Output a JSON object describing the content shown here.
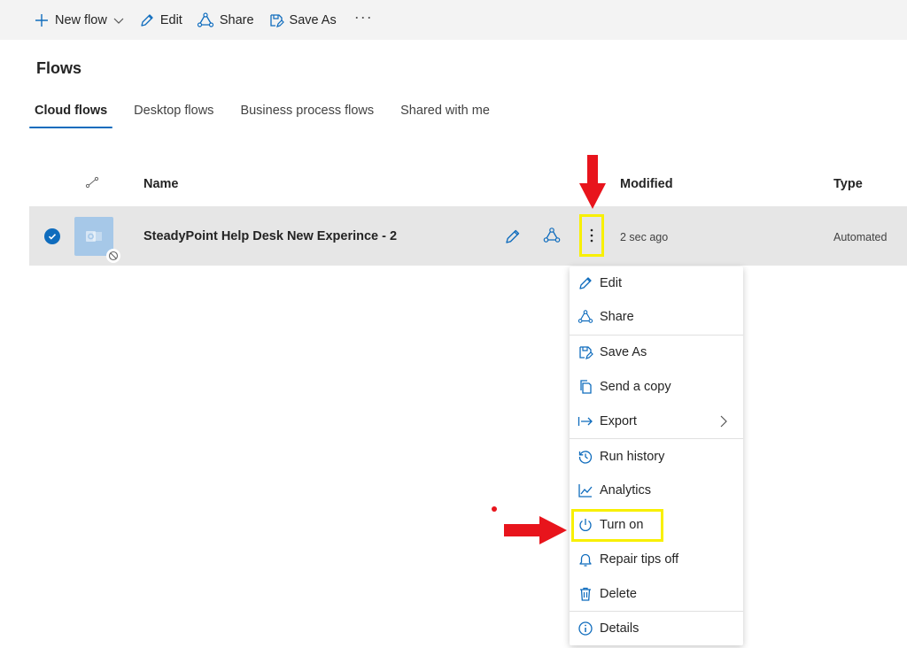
{
  "toolbar": {
    "new_flow": "New flow",
    "edit": "Edit",
    "share": "Share",
    "save_as": "Save As",
    "more": "···"
  },
  "page": {
    "title": "Flows"
  },
  "tabs": [
    {
      "label": "Cloud flows",
      "active": true
    },
    {
      "label": "Desktop flows",
      "active": false
    },
    {
      "label": "Business process flows",
      "active": false
    },
    {
      "label": "Shared with me",
      "active": false
    }
  ],
  "table": {
    "columns": {
      "name": "Name",
      "modified": "Modified",
      "type": "Type"
    },
    "rows": [
      {
        "name": "SteadyPoint Help Desk New Experince - 2",
        "modified": "2 sec ago",
        "type": "Automated",
        "selected": true
      }
    ]
  },
  "context_menu": {
    "items": [
      {
        "label": "Edit",
        "icon": "pencil-icon"
      },
      {
        "label": "Share",
        "icon": "share-icon"
      },
      {
        "label": "Save As",
        "icon": "save-as-icon"
      },
      {
        "label": "Send a copy",
        "icon": "copy-icon"
      },
      {
        "label": "Export",
        "icon": "export-icon",
        "has_submenu": true
      },
      {
        "label": "Run history",
        "icon": "history-icon"
      },
      {
        "label": "Analytics",
        "icon": "analytics-icon"
      },
      {
        "label": "Turn on",
        "icon": "power-icon",
        "highlighted": true
      },
      {
        "label": "Repair tips off",
        "icon": "bell-icon"
      },
      {
        "label": "Delete",
        "icon": "trash-icon"
      },
      {
        "label": "Details",
        "icon": "info-icon"
      }
    ]
  },
  "colors": {
    "accent": "#0f6cbd",
    "highlight_box": "#f8f000",
    "annotation_arrow": "#e8141c",
    "row_selected_bg": "#e6e6e6",
    "toolbar_bg": "#f3f3f3"
  }
}
